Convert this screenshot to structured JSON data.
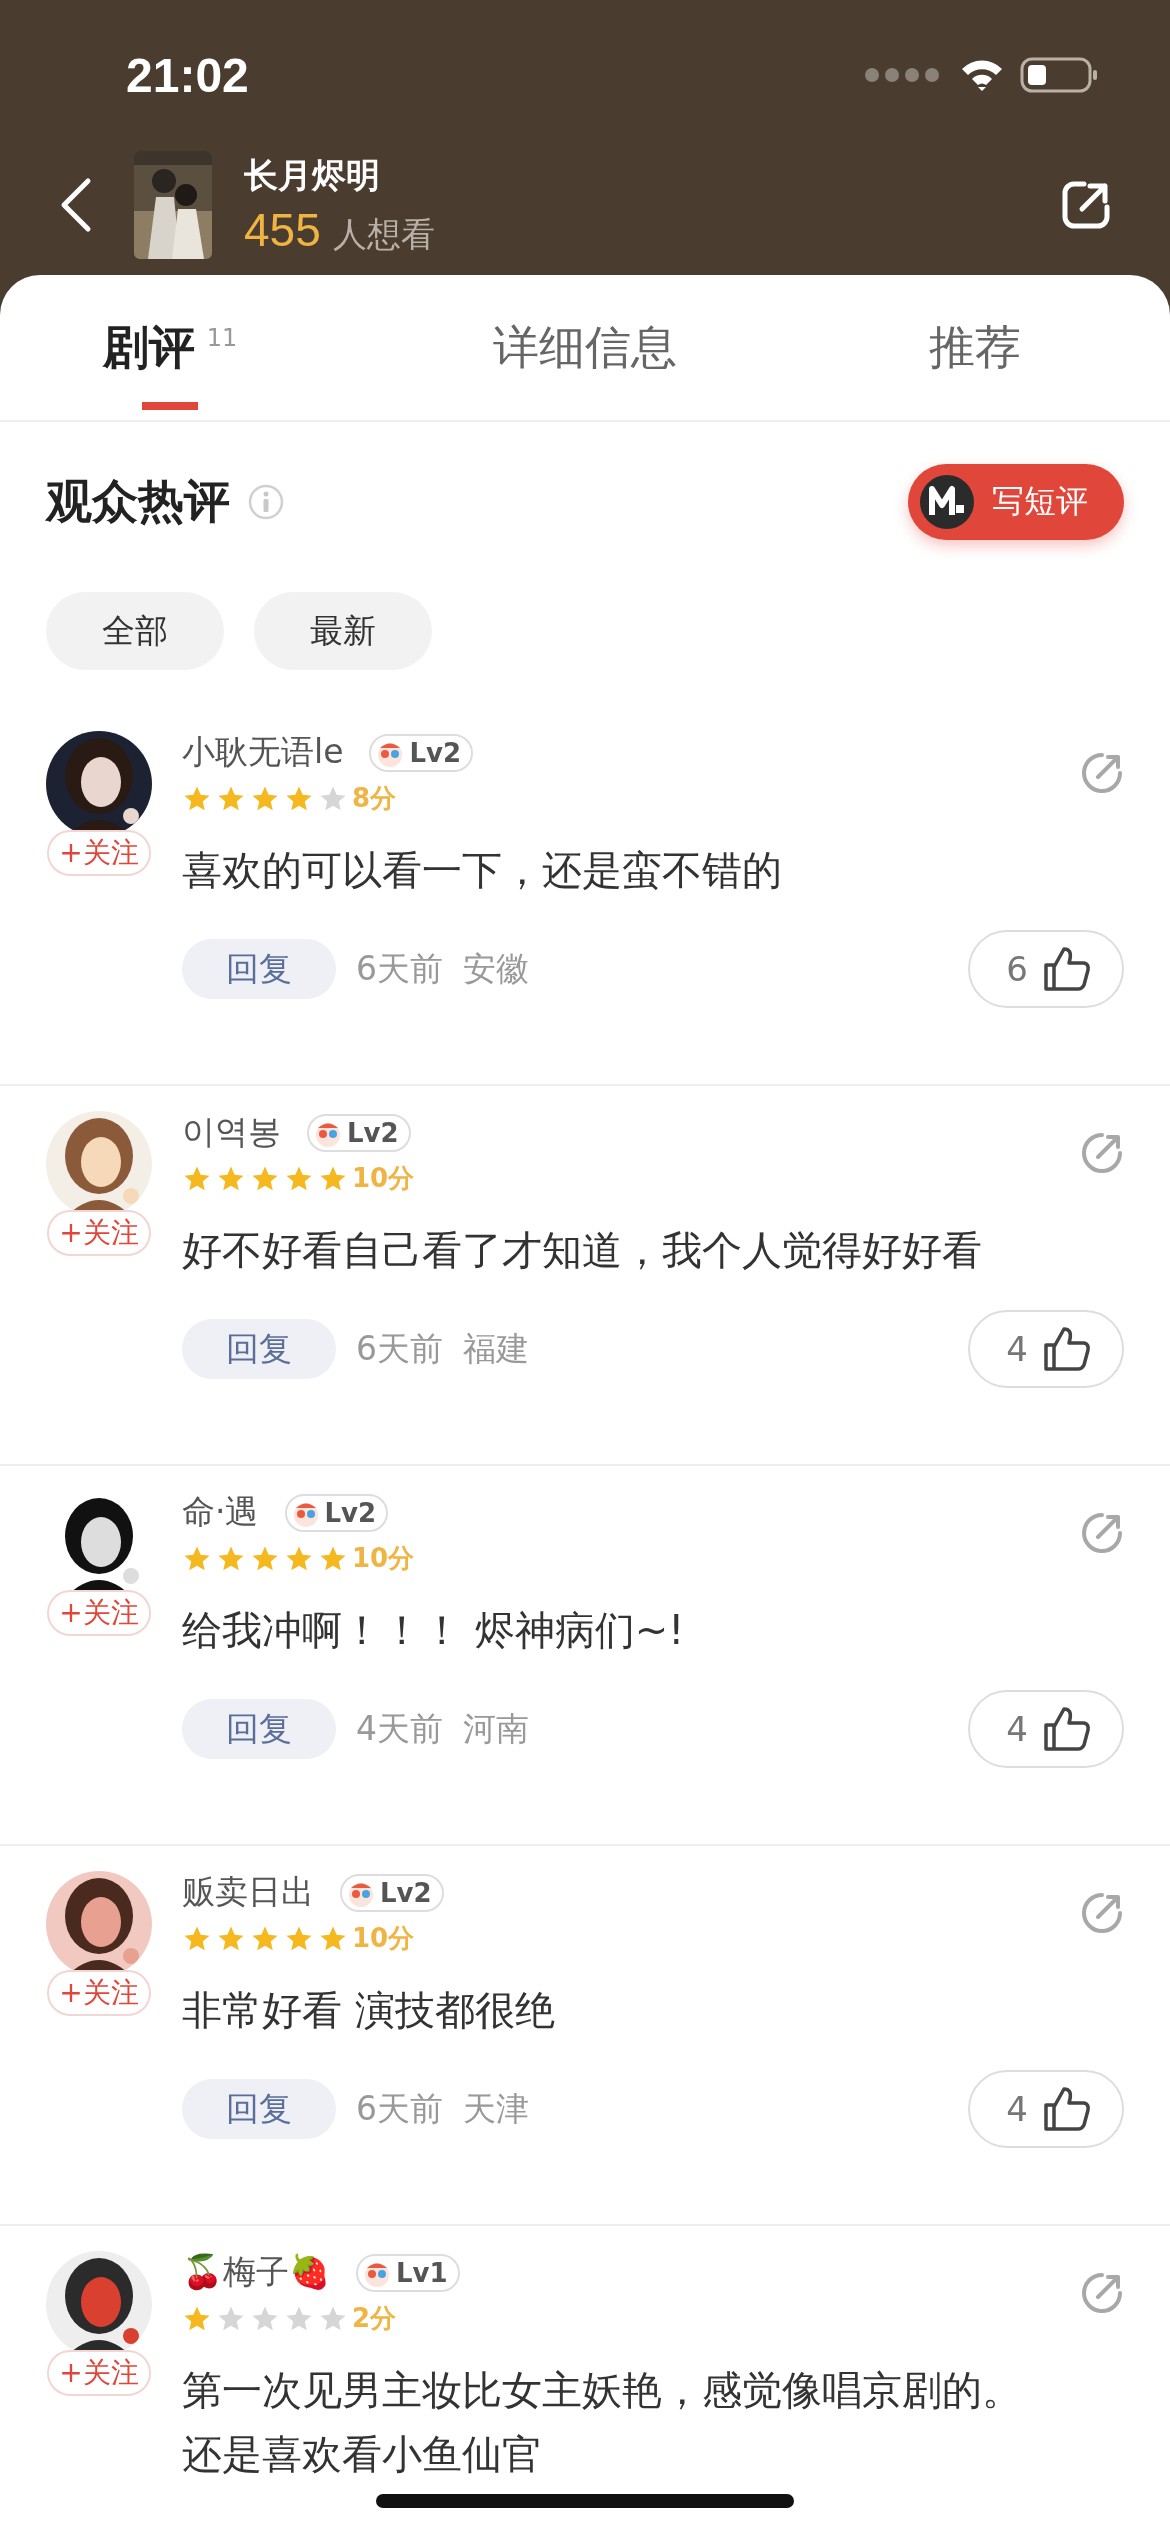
{
  "status_bar": {
    "time": "21:02"
  },
  "header": {
    "title": "长月烬明",
    "count": "455",
    "count_label": "人想看"
  },
  "tabs": [
    {
      "label": "剧评",
      "badge": "11",
      "selected": true
    },
    {
      "label": "详细信息",
      "selected": false
    },
    {
      "label": "推荐",
      "selected": false
    }
  ],
  "section": {
    "title": "观众热评",
    "write_button": "写短评"
  },
  "filters": [
    {
      "label": "全部"
    },
    {
      "label": "最新"
    }
  ],
  "comments": [
    {
      "user": "小耿无语le",
      "level": "Lv2",
      "stars": 4,
      "score": "8分",
      "follow": "+关注",
      "text": "喜欢的可以看一下，还是蛮不错的",
      "reply": "回复",
      "time": "6天前",
      "location": "安徽",
      "likes": "6"
    },
    {
      "user": "이역봉",
      "level": "Lv2",
      "stars": 5,
      "score": "10分",
      "follow": "+关注",
      "text": "好不好看自己看了才知道，我个人觉得好好看",
      "reply": "回复",
      "time": "6天前",
      "location": "福建",
      "likes": "4"
    },
    {
      "user": "命·遇",
      "level": "Lv2",
      "stars": 5,
      "score": "10分",
      "follow": "+关注",
      "text": "给我冲啊！！！ 烬神病们~!",
      "reply": "回复",
      "time": "4天前",
      "location": "河南",
      "likes": "4"
    },
    {
      "user": "贩卖日出",
      "level": "Lv2",
      "stars": 5,
      "score": "10分",
      "follow": "+关注",
      "text": "非常好看 演技都很绝",
      "reply": "回复",
      "time": "6天前",
      "location": "天津",
      "likes": "4"
    },
    {
      "user": "🍒梅子🍓",
      "level": "Lv1",
      "stars": 1,
      "score": "2分",
      "follow": "+关注",
      "text": "第一次见男主妆比女主妖艳，感觉像唱京剧的。还是喜欢看小鱼仙官"
    }
  ]
}
